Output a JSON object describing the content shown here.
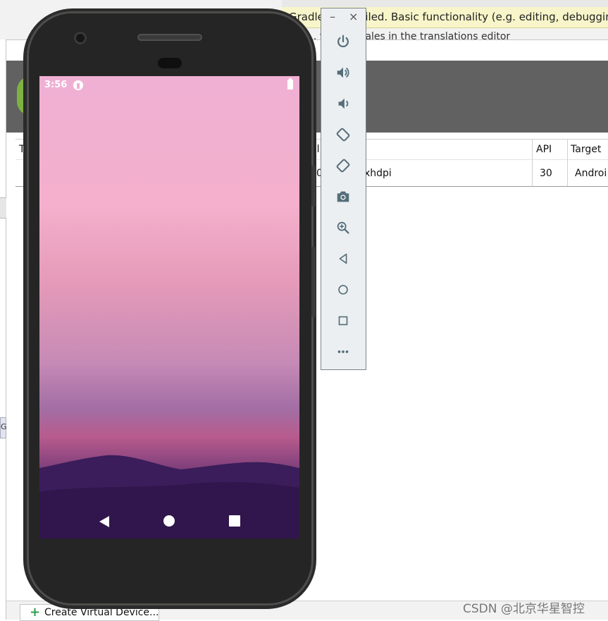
{
  "ide": {
    "notification_text": "Gradle sync failed. Basic functionality (e.g. editing, debugging",
    "notification_text_partial": "... for all locales in the translations editor",
    "table": {
      "header_first_partial": "T",
      "header_partial_col": "ol",
      "header_api": "API",
      "header_target": "Target",
      "row_density": "xhdpi",
      "row_api": "30",
      "row_target": "Androi",
      "row_partial": "0"
    },
    "side_letter": "G",
    "create_button_label": "Create Virtual Device...",
    "watermark": "CSDN @北京华星智控"
  },
  "device": {
    "status_time": "3:56"
  },
  "toolbar": {
    "minimize_label": "–",
    "close_label": "×",
    "buttons": [
      {
        "name": "power-icon"
      },
      {
        "name": "volume-up-icon"
      },
      {
        "name": "volume-down-icon"
      },
      {
        "name": "rotate-left-icon"
      },
      {
        "name": "rotate-right-icon"
      },
      {
        "name": "camera-icon"
      },
      {
        "name": "zoom-icon"
      },
      {
        "name": "back-icon"
      },
      {
        "name": "home-icon"
      },
      {
        "name": "overview-icon"
      },
      {
        "name": "more-icon"
      }
    ]
  },
  "colors": {
    "toolbar_icon": "#546e7a",
    "header_bar": "#616161",
    "notification_bg": "#f7f5c9"
  }
}
